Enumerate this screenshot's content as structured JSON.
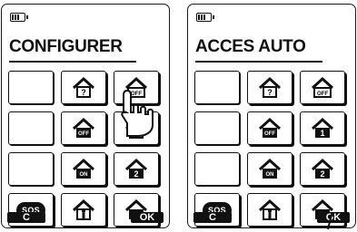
{
  "screens": [
    {
      "title": "CONFIGURER",
      "buttons": [
        "",
        "?",
        "OFF",
        "",
        "OFF",
        "",
        "",
        "ON",
        "2",
        "SOS",
        "",
        "ON"
      ],
      "softkeys": {
        "left": "C",
        "right": "OK"
      }
    },
    {
      "title": "ACCES AUTO",
      "buttons": [
        "",
        "?",
        "OFF",
        "",
        "OFF",
        "1",
        "",
        "ON",
        "2",
        "SOS",
        "",
        "ON"
      ],
      "softkeys": {
        "left": "C",
        "right": "OK"
      }
    }
  ],
  "icons": {
    "battery": "battery-icon",
    "house": "house-icon",
    "person": "person-house-icon",
    "hand": "hand-pointer-icon",
    "pointer": "pointer-icon"
  }
}
